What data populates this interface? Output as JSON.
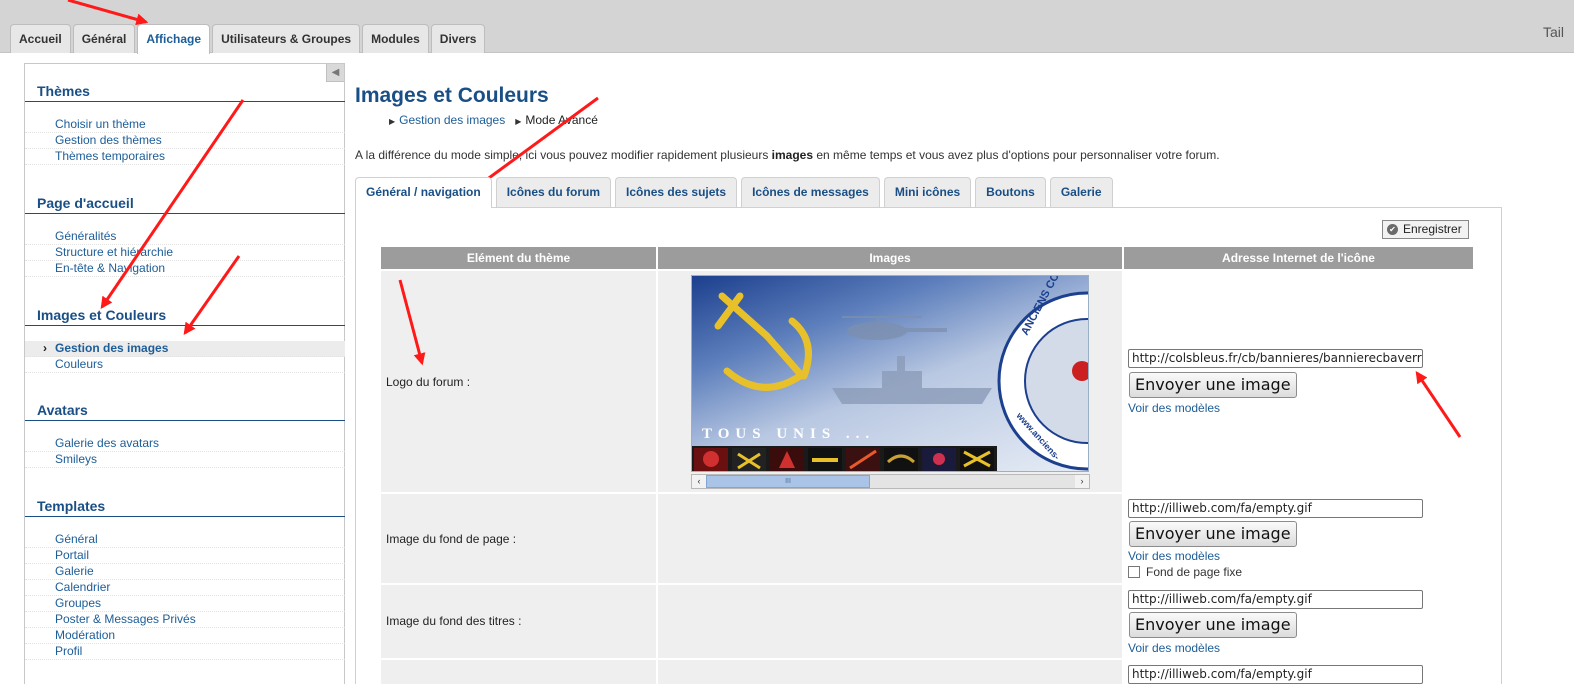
{
  "top_tabs": [
    {
      "label": "Accueil",
      "active": false
    },
    {
      "label": "Général",
      "active": false
    },
    {
      "label": "Affichage",
      "active": true
    },
    {
      "label": "Utilisateurs & Groupes",
      "active": false
    },
    {
      "label": "Modules",
      "active": false
    },
    {
      "label": "Divers",
      "active": false
    }
  ],
  "top_right_text": "Tail",
  "sidebar": {
    "sections": [
      {
        "title": "Thèmes",
        "items": [
          {
            "label": "Choisir un thème"
          },
          {
            "label": "Gestion des thèmes"
          },
          {
            "label": "Thèmes temporaires"
          }
        ]
      },
      {
        "title": "Page d'accueil",
        "items": [
          {
            "label": "Généralités"
          },
          {
            "label": "Structure et hiérarchie"
          },
          {
            "label": "En-tête & Navigation"
          }
        ]
      },
      {
        "title": "Images et Couleurs",
        "items": [
          {
            "label": "Gestion des images",
            "active": true
          },
          {
            "label": "Couleurs"
          }
        ]
      },
      {
        "title": "Avatars",
        "items": [
          {
            "label": "Galerie des avatars"
          },
          {
            "label": "Smileys"
          }
        ]
      },
      {
        "title": "Templates",
        "items": [
          {
            "label": "Général"
          },
          {
            "label": "Portail"
          },
          {
            "label": "Galerie"
          },
          {
            "label": "Calendrier"
          },
          {
            "label": "Groupes"
          },
          {
            "label": "Poster & Messages Privés"
          },
          {
            "label": "Modération"
          },
          {
            "label": "Profil"
          }
        ]
      }
    ]
  },
  "main": {
    "title": "Images et Couleurs",
    "breadcrumb": [
      "Gestion des images",
      "Mode Avancé"
    ],
    "intro_before": "A la différence du mode simple, ici vous pouvez modifier rapidement plusieurs ",
    "intro_bold": "images",
    "intro_after": " en même temps et vous avez plus d'options pour personnaliser votre forum.",
    "sub_tabs": [
      {
        "label": "Général / navigation",
        "active": true
      },
      {
        "label": "Icônes du forum"
      },
      {
        "label": "Icônes des sujets"
      },
      {
        "label": "Icônes de messages"
      },
      {
        "label": "Mini icônes"
      },
      {
        "label": "Boutons"
      },
      {
        "label": "Galerie"
      }
    ],
    "save_label": "Enregistrer",
    "table": {
      "headers": [
        "Elément du thème",
        "Images",
        "Adresse Internet de l'icône"
      ],
      "rows": [
        {
          "label": "Logo du forum :",
          "url": "http://colsbleus.fr/cb/bannieres/bannierecbaverr",
          "upload": "Envoyer une image",
          "models": "Voir des modèles"
        },
        {
          "label": "Image du fond de page :",
          "url": "http://illiweb.com/fa/empty.gif",
          "upload": "Envoyer une image",
          "models": "Voir des modèles",
          "checkbox": "Fond de page fixe"
        },
        {
          "label": "Image du fond des titres :",
          "url": "http://illiweb.com/fa/empty.gif",
          "upload": "Envoyer une image",
          "models": "Voir des modèles"
        },
        {
          "label": "",
          "url": "http://illiweb.com/fa/empty.gif"
        }
      ]
    },
    "banner": {
      "text": "TOUS UNIS ...",
      "arc_text": "ANCIENS COLS BLEUS",
      "bottom_text": "www.anciens-",
      "colors": {
        "dark_blue": "#1c3f8e",
        "gold": "#e8c12a",
        "light": "#e6ecf5"
      }
    },
    "scroll_thumb_label": "III"
  },
  "colors": {
    "accent": "#1a4f86",
    "link": "#1d5d98",
    "header_gray": "#9c9c9c",
    "arrow_red": "#ff1a1a"
  }
}
